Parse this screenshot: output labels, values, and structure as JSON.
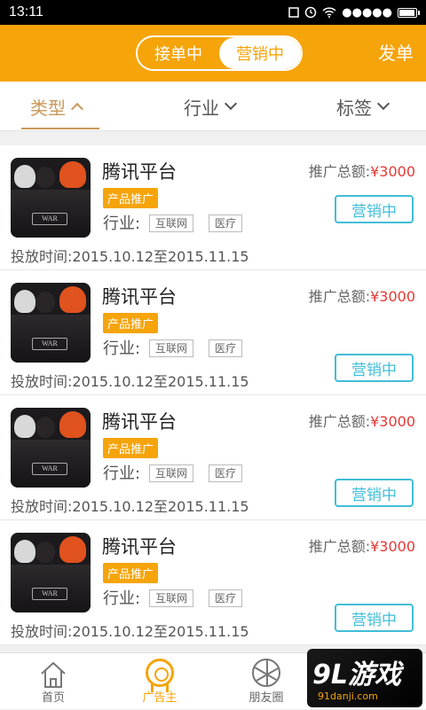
{
  "status_bar": {
    "time": "13:11",
    "signal": "●●●●●"
  },
  "header": {
    "tabs": [
      {
        "label": "接单中",
        "selected": false
      },
      {
        "label": "营销中",
        "selected": true
      }
    ],
    "publish_label": "发单"
  },
  "filters": [
    {
      "label": "类型",
      "active": true
    },
    {
      "label": "行业",
      "active": false
    },
    {
      "label": "标签",
      "active": false
    }
  ],
  "colors": {
    "brand": "#f5a40a",
    "accent_cyan": "#42bdd8",
    "amount_red": "#e53935",
    "filter_active": "#c9985a"
  },
  "listings": [
    {
      "title": "腾讯平台",
      "badge": "产品推广",
      "industry_label": "行业:",
      "tags": [
        "互联网",
        "医疗"
      ],
      "period": "投放时间:2015.10.12至2015.11.15",
      "amount_label": "推广总额:",
      "amount": "¥3000",
      "status": "营销中",
      "thumb_logo": "WAR"
    },
    {
      "title": "腾讯平台",
      "badge": "产品推广",
      "industry_label": "行业:",
      "tags": [
        "互联网",
        "医疗"
      ],
      "period": "投放时间:2015.10.12至2015.11.15",
      "amount_label": "推广总额:",
      "amount": "¥3000",
      "status": "营销中",
      "thumb_logo": "WAR"
    },
    {
      "title": "腾讯平台",
      "badge": "产品推广",
      "industry_label": "行业:",
      "tags": [
        "互联网",
        "医疗"
      ],
      "period": "投放时间:2015.10.12至2015.11.15",
      "amount_label": "推广总额:",
      "amount": "¥3000",
      "status": "营销中",
      "thumb_logo": "WAR"
    },
    {
      "title": "腾讯平台",
      "badge": "产品推广",
      "industry_label": "行业:",
      "tags": [
        "互联网",
        "医疗"
      ],
      "period": "投放时间:2015.10.12至2015.11.15",
      "amount_label": "推广总额:",
      "amount": "¥3000",
      "status": "营销中",
      "thumb_logo": "WAR"
    }
  ],
  "tabbar": [
    {
      "label": "首页",
      "icon": "home-icon",
      "active": false
    },
    {
      "label": "广告主",
      "icon": "medal-icon",
      "active": true
    },
    {
      "label": "朋友圈",
      "icon": "aperture-icon",
      "active": false
    }
  ],
  "watermark": {
    "big": "9L游戏",
    "small": "91danji.com"
  }
}
